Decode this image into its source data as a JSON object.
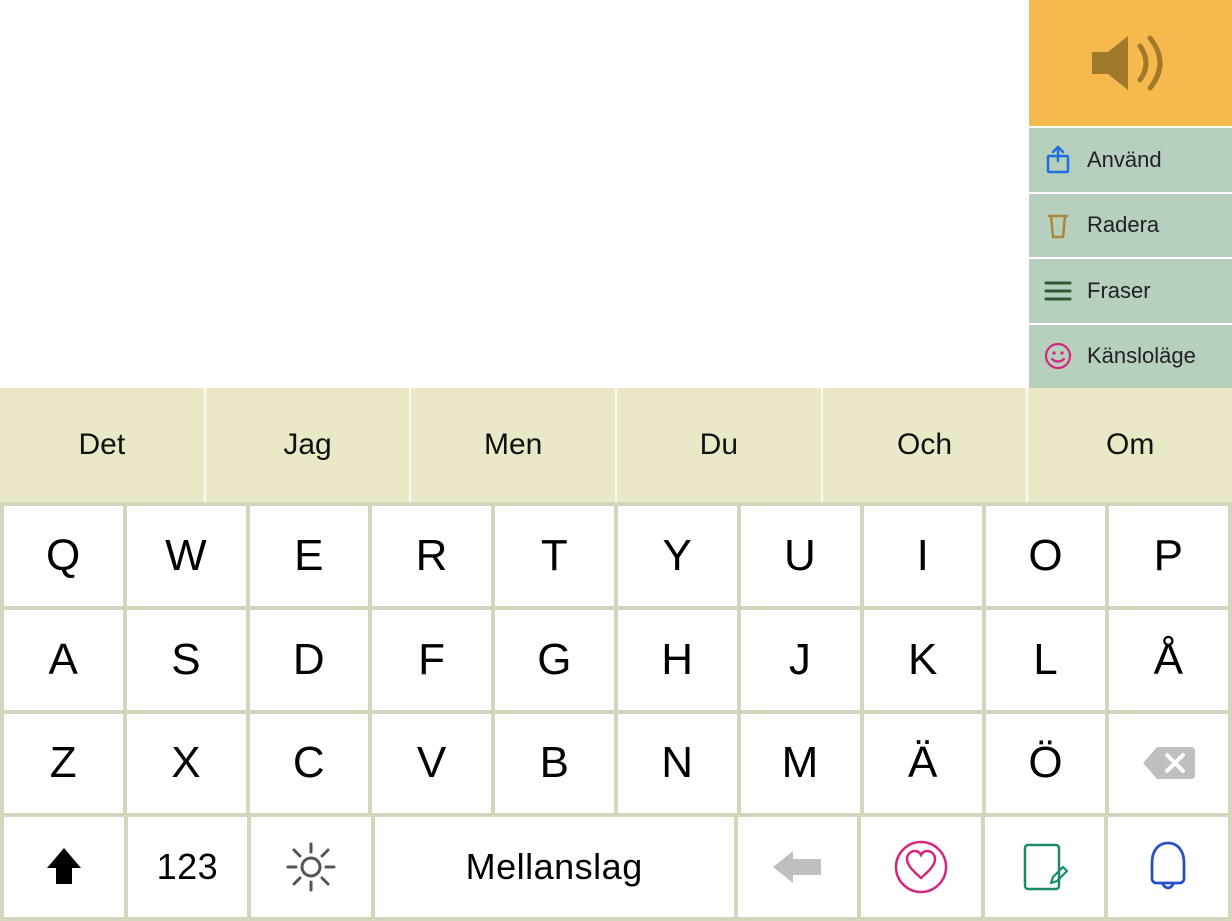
{
  "side": {
    "use": "Använd",
    "delete": "Radera",
    "phrases": "Fraser",
    "mood": "Känsloläge"
  },
  "suggestions": [
    "Det",
    "Jag",
    "Men",
    "Du",
    "Och",
    "Om"
  ],
  "keyboard": {
    "row1": [
      "Q",
      "W",
      "E",
      "R",
      "T",
      "Y",
      "U",
      "I",
      "O",
      "P"
    ],
    "row2": [
      "A",
      "S",
      "D",
      "F",
      "G",
      "H",
      "J",
      "K",
      "L",
      "Å"
    ],
    "row3": [
      "Z",
      "X",
      "C",
      "V",
      "B",
      "N",
      "M",
      "Ä",
      "Ö"
    ],
    "numbers": "123",
    "space": "Mellanslag"
  }
}
